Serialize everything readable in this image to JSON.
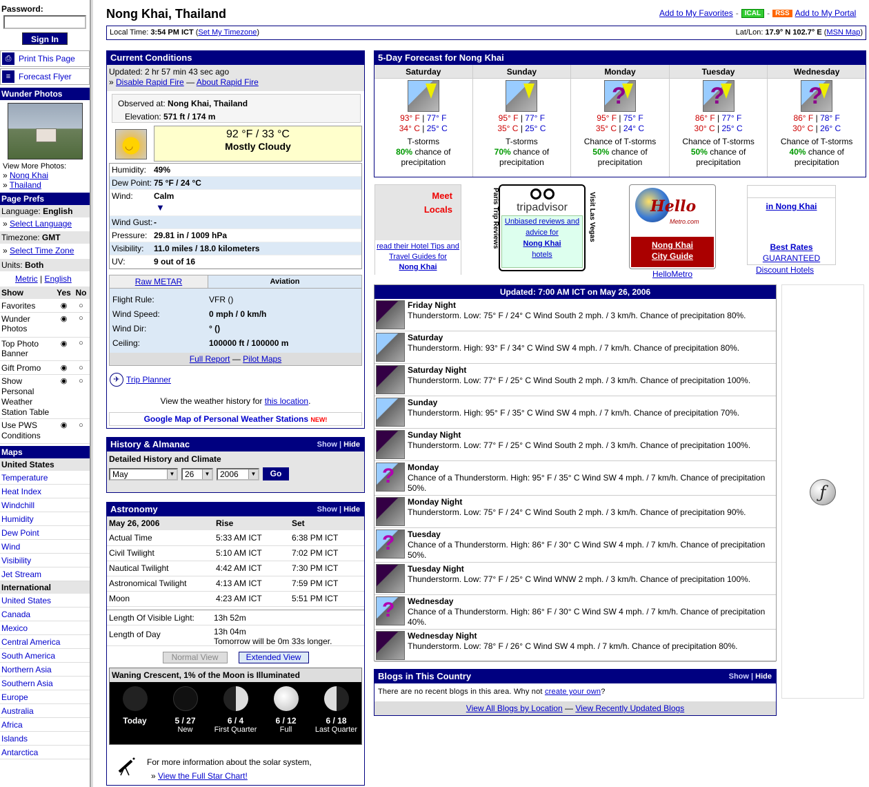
{
  "sidebar": {
    "password_label": "Password:",
    "signin": "Sign In",
    "print": "Print This Page",
    "flyer": "Forecast Flyer",
    "photos_head": "Wunder Photos",
    "view_more": "View More Photos:",
    "photo_links": [
      "Nong Khai",
      "Thailand"
    ],
    "prefs_head": "Page Prefs",
    "language_label": "Language:",
    "language_value": "English",
    "select_language": "Select Language",
    "timezone_label": "Timezone:",
    "timezone_value": "GMT",
    "select_timezone": "Select Time Zone",
    "units_label": "Units:",
    "units_value": "Both",
    "unit_metric": "Metric",
    "unit_english": "English",
    "show_label": "Show",
    "yes_label": "Yes",
    "no_label": "No",
    "prefs": [
      "Favorites",
      "Wunder Photos",
      "Top Photo Banner",
      "Gift Promo",
      "Show Personal Weather Station Table",
      "Use PWS Conditions"
    ],
    "maps_head": "Maps",
    "us_head": "United States",
    "us_maps": [
      "Temperature",
      "Heat Index",
      "Windchill",
      "Humidity",
      "Dew Point",
      "Wind",
      "Visibility",
      "Jet Stream"
    ],
    "intl_head": "International",
    "intl_maps": [
      "United States",
      "Canada",
      "Mexico",
      "Central America",
      "South America",
      "Northern Asia",
      "Southern Asia",
      "Europe",
      "Australia",
      "Africa",
      "Islands",
      "Antarctica"
    ]
  },
  "header": {
    "title": "Nong Khai, Thailand",
    "add_fav": "Add to My Favorites",
    "ical": "ICAL",
    "rss": "RSS",
    "add_portal": "Add to My Portal",
    "local_time_label": "Local Time:",
    "local_time": "3:54 PM ICT",
    "set_tz": "Set My Timezone",
    "latlon_label": "Lat/Lon:",
    "latlon": "17.9° N 102.7° E",
    "msn_map": "MSN Map"
  },
  "current": {
    "head": "Current Conditions",
    "updated_label": "Updated:",
    "updated": "2 hr 57 min 43 sec ago",
    "disable_rf": "Disable Rapid Fire",
    "about_rf": "About Rapid Fire",
    "observed_label": "Observed at:",
    "observed": "Nong Khai, Thailand",
    "elev_label": "Elevation:",
    "elev": "571 ft / 174 m",
    "temp": "92 °F / 33 °C",
    "cond": "Mostly Cloudy",
    "rows": [
      {
        "k": "Humidity:",
        "v": "49%"
      },
      {
        "k": "Dew Point:",
        "v": "75 °F / 24 °C"
      },
      {
        "k": "Wind:",
        "v": "Calm"
      },
      {
        "k": "Wind Gust:",
        "v": "-"
      },
      {
        "k": "Pressure:",
        "v": "29.81 in / 1009 hPa"
      },
      {
        "k": "Visibility:",
        "v": "11.0 miles / 18.0 kilometers"
      },
      {
        "k": "UV:",
        "v": "9 out of 16"
      }
    ],
    "tab_raw": "Raw METAR",
    "tab_aviation": "Aviation",
    "aviation": [
      {
        "k": "Flight Rule:",
        "v": "VFR ()"
      },
      {
        "k": "Wind Speed:",
        "v": "0 mph / 0 km/h"
      },
      {
        "k": "Wind Dir:",
        "v": "° ()"
      },
      {
        "k": "Ceiling:",
        "v": "100000 ft / 100000 m"
      }
    ],
    "full_report": "Full Report",
    "pilot_maps": "Pilot Maps",
    "trip_planner": "Trip Planner",
    "history_text": "View the weather history for",
    "history_link": "this location",
    "gmap": "Google Map of Personal Weather Stations",
    "new_tag": "NEW!"
  },
  "history": {
    "head": "History & Almanac",
    "show": "Show",
    "hide": "Hide",
    "label": "Detailed History and Climate",
    "month": "May",
    "day": "26",
    "year": "2006",
    "go": "Go"
  },
  "astronomy": {
    "head": "Astronomy",
    "show": "Show",
    "hide": "Hide",
    "date": "May 26, 2006",
    "rise_h": "Rise",
    "set_h": "Set",
    "rows": [
      {
        "n": "Actual Time",
        "r": "5:33 AM ICT",
        "s": "6:38 PM ICT"
      },
      {
        "n": "Civil Twilight",
        "r": "5:10 AM ICT",
        "s": "7:02 PM ICT"
      },
      {
        "n": "Nautical Twilight",
        "r": "4:42 AM ICT",
        "s": "7:30 PM ICT"
      },
      {
        "n": "Astronomical Twilight",
        "r": "4:13 AM ICT",
        "s": "7:59 PM ICT"
      },
      {
        "n": "Moon",
        "r": "4:23 AM ICT",
        "s": "5:51 PM ICT"
      }
    ],
    "lvl_label": "Length Of Visible Light:",
    "lvl": "13h 52m",
    "lod_label": "Length of Day",
    "lod": "13h 04m",
    "tomorrow": "Tomorrow will be 0m 33s longer.",
    "normal_view": "Normal View",
    "extended_view": "Extended View",
    "moon_head": "Waning Crescent, 1% of the Moon is Illuminated",
    "phases": [
      {
        "d": "Today",
        "n": ""
      },
      {
        "d": "5 / 27",
        "n": "New"
      },
      {
        "d": "6 / 4",
        "n": "First Quarter"
      },
      {
        "d": "6 / 12",
        "n": "Full"
      },
      {
        "d": "6 / 18",
        "n": "Last Quarter"
      }
    ],
    "more_info": "For more information about the solar system,",
    "star_chart": "View the Full Star Chart!"
  },
  "forecast": {
    "head": "5-Day Forecast for Nong Khai",
    "days": [
      {
        "day": "Saturday",
        "f": "93° F",
        "fl": "77° F",
        "c": "34° C",
        "cl": "25° C",
        "cond": "T-storms",
        "pct": "80%",
        "q": false
      },
      {
        "day": "Sunday",
        "f": "95° F",
        "fl": "77° F",
        "c": "35° C",
        "cl": "25° C",
        "cond": "T-storms",
        "pct": "70%",
        "q": false
      },
      {
        "day": "Monday",
        "f": "95° F",
        "fl": "75° F",
        "c": "35° C",
        "cl": "24° C",
        "cond": "Chance of T-storms",
        "pct": "50%",
        "q": true
      },
      {
        "day": "Tuesday",
        "f": "86° F",
        "fl": "77° F",
        "c": "30° C",
        "cl": "25° C",
        "cond": "Chance of T-storms",
        "pct": "50%",
        "q": true
      },
      {
        "day": "Wednesday",
        "f": "86° F",
        "fl": "78° F",
        "c": "30° C",
        "cl": "26° C",
        "cond": "Chance of T-storms",
        "pct": "40%",
        "q": true
      }
    ],
    "chance_of": "chance of",
    "precip": "precipitation"
  },
  "ads": {
    "meet": "Meet",
    "locals": "Locals",
    "tips": "read their Hotel Tips and Travel Guides for",
    "tips_city": "Nong Khai",
    "paris": "Paris Trip Reviews",
    "ta_name": "tripadvisor",
    "ta_text": "Unbiased reviews and advice for",
    "ta_city": "Nong Khai",
    "ta_hotels": "hotels",
    "vegas": "Visit Las Vegas",
    "hello_logo": "Hello",
    "hello_sub": "Metro.com",
    "hello_city": "Nong Khai City Guide",
    "hello_link": "HelloMetro",
    "in_city": "in Nong Khai",
    "best_rates": "Best Rates",
    "guaranteed": "GUARANTEED",
    "discount": "Discount Hotels"
  },
  "detail": {
    "updated": "Updated: 7:00 AM ICT on May 26, 2006",
    "rows": [
      {
        "n": "Friday Night",
        "t": "Thunderstorm. Low: 75° F / 24° C Wind South 2 mph. / 3 km/h. Chance of precipitation 80%.",
        "i": "night"
      },
      {
        "n": "Saturday",
        "t": "Thunderstorm. High: 93° F / 34° C Wind SW 4 mph. / 7 km/h. Chance of precipitation 80%.",
        "i": "day"
      },
      {
        "n": "Saturday Night",
        "t": "Thunderstorm. Low: 77° F / 25° C Wind South 2 mph. / 3 km/h. Chance of precipitation 100%.",
        "i": "night"
      },
      {
        "n": "Sunday",
        "t": "Thunderstorm. High: 95° F / 35° C Wind SW 4 mph. / 7 km/h. Chance of precipitation 70%.",
        "i": "day"
      },
      {
        "n": "Sunday Night",
        "t": "Thunderstorm. Low: 77° F / 25° C Wind South 2 mph. / 3 km/h. Chance of precipitation 100%.",
        "i": "night"
      },
      {
        "n": "Monday",
        "t": "Chance of a Thunderstorm. High: 95° F / 35° C Wind SW 4 mph. / 7 km/h. Chance of precipitation 50%.",
        "i": "q"
      },
      {
        "n": "Monday Night",
        "t": "Thunderstorm. Low: 75° F / 24° C Wind South 2 mph. / 3 km/h. Chance of precipitation 90%.",
        "i": "night"
      },
      {
        "n": "Tuesday",
        "t": "Chance of a Thunderstorm. High: 86° F / 30° C Wind SW 4 mph. / 7 km/h. Chance of precipitation 50%.",
        "i": "q"
      },
      {
        "n": "Tuesday Night",
        "t": "Thunderstorm. Low: 77° F / 25° C Wind WNW 2 mph. / 3 km/h. Chance of precipitation 100%.",
        "i": "night"
      },
      {
        "n": "Wednesday",
        "t": "Chance of a Thunderstorm. High: 86° F / 30° C Wind SW 4 mph. / 7 km/h. Chance of precipitation 40%.",
        "i": "q"
      },
      {
        "n": "Wednesday Night",
        "t": "Thunderstorm. Low: 78° F / 26° C Wind SW 4 mph. / 7 km/h. Chance of precipitation 80%.",
        "i": "night"
      }
    ]
  },
  "blogs": {
    "head": "Blogs in This Country",
    "show": "Show",
    "hide": "Hide",
    "none_text": "There are no recent blogs in this area. Why not",
    "create": "create your own",
    "view_loc": "View All Blogs by Location",
    "view_recent": "View Recently Updated Blogs"
  },
  "colors": {
    "navy": "#000080",
    "link": "#0000cc",
    "temp_red": "#cc0000",
    "pct_green": "#009900",
    "cond_yellow": "#ffffcc"
  }
}
